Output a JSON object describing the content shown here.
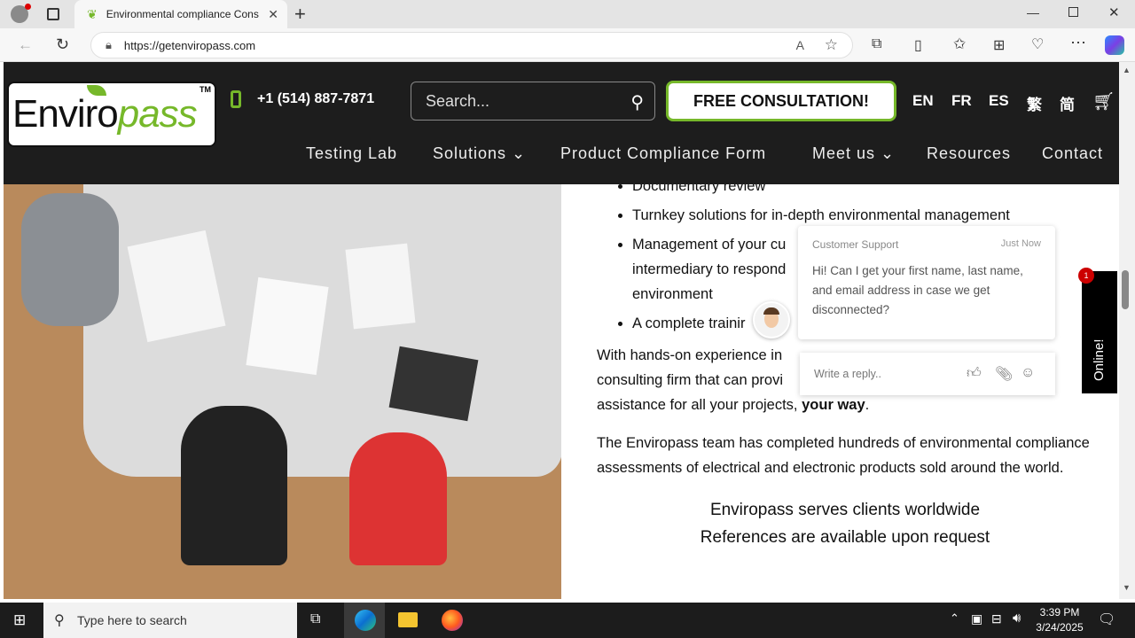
{
  "browser": {
    "tab_title": "Environmental compliance Cons",
    "url": "https://getenviropass.com",
    "new_tab": "+"
  },
  "site": {
    "logo": {
      "part1": "Enviro",
      "part2": "pass",
      "tm": "TM"
    },
    "phone": "+1 (514) 887-7871",
    "search_placeholder": "Search...",
    "consult_button": "FREE CONSULTATION!",
    "languages": [
      "EN",
      "FR",
      "ES",
      "繁",
      "简"
    ],
    "nav": [
      "Testing Lab",
      "Solutions ⌄",
      "Product Compliance Form",
      "Meet us ⌄",
      "Resources",
      "Contact"
    ]
  },
  "content": {
    "bullets": [
      "Documentary review",
      "Turnkey solutions for in-depth environmental management",
      "Management of your cu",
      "intermediary to respond",
      "environment",
      "A complete trainir"
    ],
    "para1_a": "With hands-on experience in",
    "para1_b": "consulting firm that can provi",
    "para1_c": "assistance for all your projects,",
    "para1_bold": "your way",
    "para1_end": ".",
    "para2": "The Enviropass team has completed hundreds of environmental compliance assessments of electrical and electronic products sold around the world.",
    "center1": "Enviropass serves clients worldwide",
    "center2": "References are available upon request"
  },
  "chat": {
    "sender": "Customer Support",
    "time": "Just Now",
    "message": "Hi! Can I get your first name, last name, and email address in case we get disconnected?",
    "reply_placeholder": "Write a reply..",
    "online_label": "Online!",
    "badge": "1"
  },
  "taskbar": {
    "search_placeholder": "Type here to search",
    "time": "3:39 PM",
    "date": "3/24/2025"
  }
}
